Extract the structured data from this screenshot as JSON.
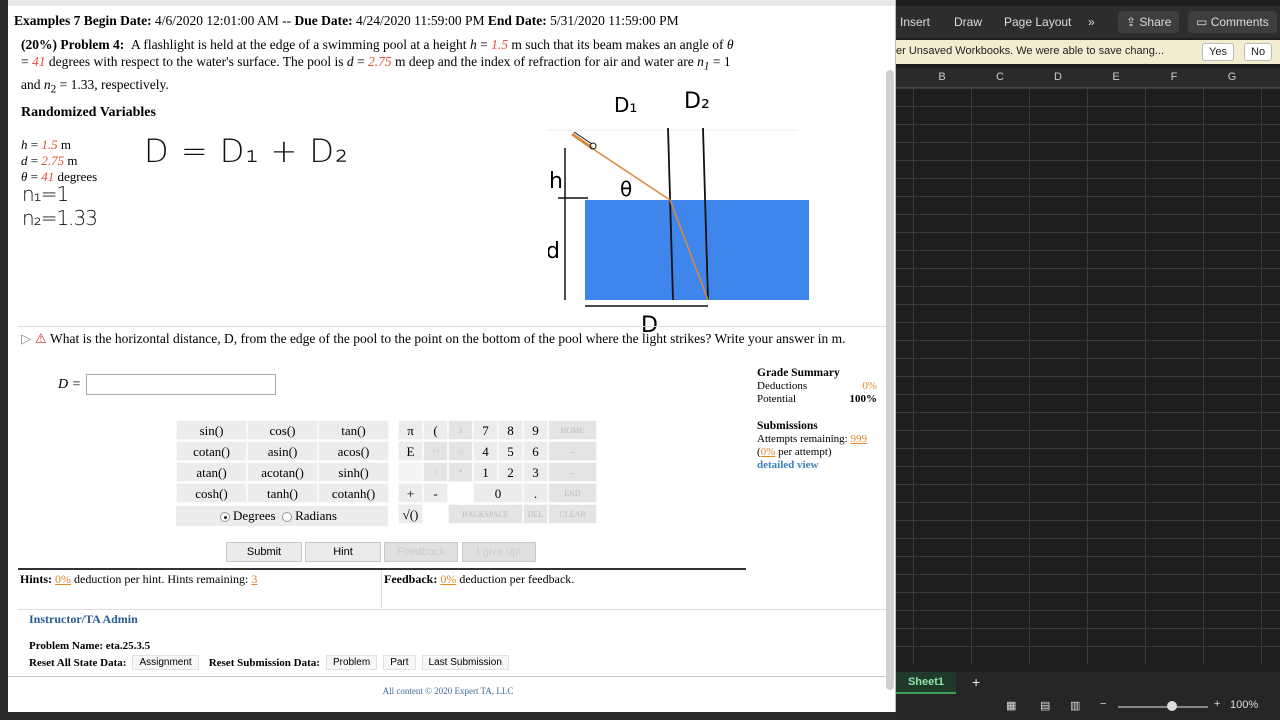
{
  "browser": {
    "header": {
      "assignment": "Examples 7",
      "begin_label": "Begin Date:",
      "begin_date": "4/6/2020 12:01:00 AM",
      "sep": "--",
      "due_label": "Due Date:",
      "due_date": "4/24/2020 11:59:00 PM",
      "end_label": "End Date:",
      "end_date": "5/31/2020 11:59:00 PM"
    },
    "problem": {
      "weight": "(20%)",
      "number": "Problem 4:",
      "t1": "A flashlight is held at the edge of a swimming pool at a height",
      "h_sym": "h",
      "eq": "=",
      "h_val": "1.5",
      "t2": "m such that its beam makes an angle of",
      "theta_sym": "θ",
      "theta_val": "41",
      "t3": "degrees with respect to the water's surface. The pool is",
      "d_sym": "d",
      "d_val": "2.75",
      "t4": "m deep and the index of refraction for air and water are",
      "n1": "n",
      "n1_sub": "1",
      "n1_val": "= 1",
      "t5": "and",
      "n2": "n",
      "n2_sub": "2",
      "t6": "= 1.33, respectively."
    },
    "randomized": {
      "heading": "Randomized Variables",
      "rows": [
        {
          "sym": "h",
          "val": "1.5",
          "unit": "m"
        },
        {
          "sym": "d",
          "val": "2.75",
          "unit": "m"
        },
        {
          "sym": "θ",
          "val": "41",
          "unit": "degrees"
        }
      ]
    },
    "handwriting": {
      "n1": "n₁=1",
      "n2": "n₂=1.33",
      "equation": "D = D₁ + D₂"
    },
    "diagram": {
      "labels": {
        "d1": "D₁",
        "d2": "D₂",
        "h": "h",
        "theta": "θ",
        "d": "d",
        "D": "D"
      },
      "colors": {
        "water": "#3f86ec",
        "beam": "#d98a3c"
      }
    },
    "question": {
      "text": "What is the horizontal distance, D, from the edge of the pool to the point on the bottom of the pool where the light strikes? Write your answer in m.",
      "answer_label": "D =",
      "answer_value": ""
    },
    "calculator": {
      "func_rows": [
        [
          "sin()",
          "cos()",
          "tan()"
        ],
        [
          "cotan()",
          "asin()",
          "acos()"
        ],
        [
          "atan()",
          "acotan()",
          "sinh()"
        ],
        [
          "cosh()",
          "tanh()",
          "cotanh()"
        ]
      ],
      "col4": [
        "π",
        "E",
        "",
        "+",
        "√()"
      ],
      "col5": [
        "(",
        "↑^",
        "/",
        "-"
      ],
      "col6": [
        ")",
        "↓\\",
        "*",
        ""
      ],
      "digits": [
        [
          "7",
          "8",
          "9"
        ],
        [
          "4",
          "5",
          "6"
        ],
        [
          "1",
          "2",
          "3"
        ],
        [
          "0",
          "."
        ]
      ],
      "side": [
        "HOME",
        "→",
        "←",
        "END"
      ],
      "backspace": "BACKSPACE",
      "del": "DEL",
      "clear": "CLEAR",
      "degrees": "Degrees",
      "radians": "Radians"
    },
    "actions": {
      "submit": "Submit",
      "hint": "Hint",
      "feedback": "Feedback",
      "give_up": "I give up!"
    },
    "hints": {
      "label": "Hints:",
      "pct": "0%",
      "text": "deduction per hint. Hints remaining:",
      "remaining": "3"
    },
    "feedback": {
      "label": "Feedback:",
      "pct": "0%",
      "text": "deduction per feedback."
    },
    "grade": {
      "title": "Grade Summary",
      "deductions_label": "Deductions",
      "deductions_value": "0%",
      "potential_label": "Potential",
      "potential_value": "100%",
      "submissions_title": "Submissions",
      "attempts_label": "Attempts remaining:",
      "attempts_value": "999",
      "per_attempt_open": "(",
      "per_attempt_pct": "0%",
      "per_attempt_text": "per attempt)",
      "detail_link": "detailed view"
    },
    "admin": {
      "link": "Instructor/TA Admin",
      "problem_name": "Problem Name: eta.25.3.5",
      "reset_state_label": "Reset All State Data:",
      "assignment_btn": "Assignment",
      "reset_sub_label": "Reset Submission Data:",
      "problem_btn": "Problem",
      "part_btn": "Part",
      "last_sub_btn": "Last Submission"
    },
    "copyright": "All content © 2020 Expert TA, LLC"
  },
  "excel": {
    "tabs": [
      "Insert",
      "Draw",
      "Page Layout"
    ],
    "more": "»",
    "share": "Share",
    "comments": "Comments",
    "message": "er Unsaved Workbooks.  We were able to save chang...",
    "yes": "Yes",
    "no": "No",
    "columns": [
      "B",
      "C",
      "D",
      "E",
      "F",
      "G"
    ],
    "sheet_tab": "Sheet1",
    "add_sheet": "+",
    "zoom": "100%",
    "zoom_fraction": 0.6
  }
}
